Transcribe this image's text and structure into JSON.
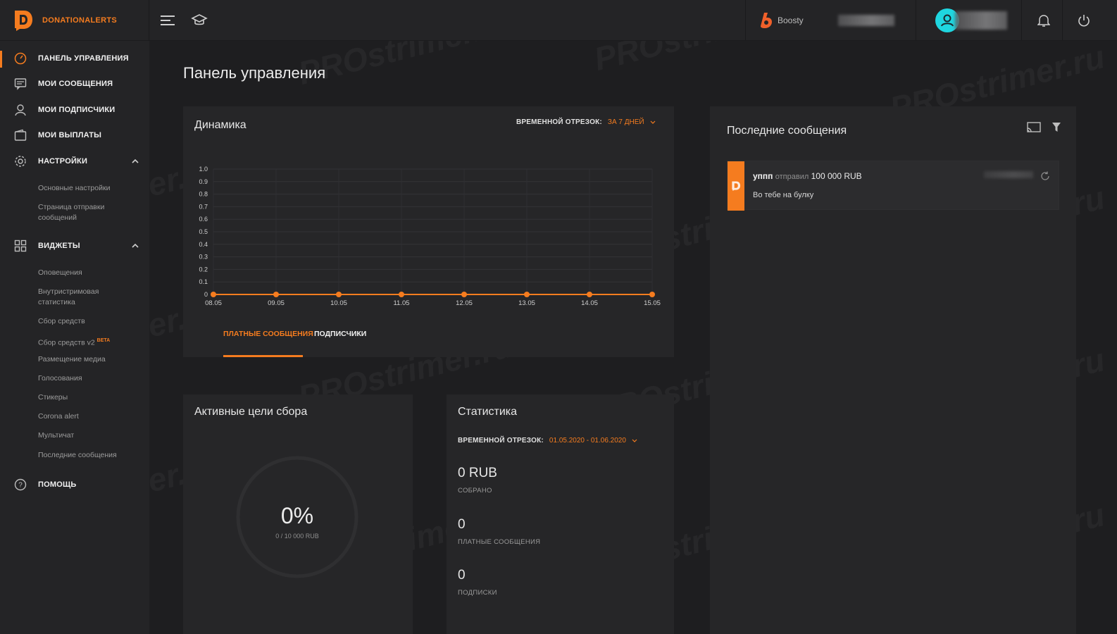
{
  "brand": {
    "name": "DONATIONALERTS",
    "accent": "#f57c1f"
  },
  "topbar": {
    "boosty_label": "Boosty",
    "icons": [
      "menu-icon",
      "graduation-cap-icon",
      "bell-icon",
      "power-icon"
    ]
  },
  "sidebar": {
    "items": [
      {
        "label": "ПАНЕЛЬ УПРАВЛЕНИЯ",
        "icon": "dashboard-icon"
      },
      {
        "label": "МОИ СООБЩЕНИЯ",
        "icon": "messages-icon"
      },
      {
        "label": "МОИ ПОДПИСЧИКИ",
        "icon": "user-icon"
      },
      {
        "label": "МОИ ВЫПЛАТЫ",
        "icon": "wallet-icon"
      },
      {
        "label": "НАСТРОЙКИ",
        "icon": "gear-icon"
      },
      {
        "label": "ВИДЖЕТЫ",
        "icon": "widgets-icon"
      },
      {
        "label": "ПОМОЩЬ",
        "icon": "help-icon"
      }
    ],
    "settings_sub": [
      "Основные настройки",
      "Страница отправки сообщений"
    ],
    "widgets_sub": [
      "Оповещения",
      "Внутристримовая статистика",
      "Сбор средств",
      "Сбор средств v2",
      "Размещение медиа",
      "Голосования",
      "Стикеры",
      "Corona alert",
      "Мультичат",
      "Последние сообщения"
    ],
    "beta_label": "BETA"
  },
  "main": {
    "title": "Панель управления",
    "dynamics": {
      "title": "Динамика",
      "period_label": "ВРЕМЕННОЙ ОТРЕЗОК:",
      "period_value": "ЗА 7 ДНЕЙ",
      "tabs": [
        "ПЛАТНЫЕ СООБЩЕНИЯ",
        "ПОДПИСЧИКИ"
      ]
    },
    "goals": {
      "title": "Активные цели сбора",
      "percent": "0%",
      "progress_text": "0 / 10 000 RUB",
      "progress": 0
    },
    "stats": {
      "title": "Статистика",
      "period_label": "ВРЕМЕННОЙ ОТРЕЗОК:",
      "period_value": "01.05.2020 - 01.06.2020",
      "collected_value": "0 RUB",
      "collected_label": "СОБРАНО",
      "paid_value": "0",
      "paid_label": "ПЛАТНЫЕ СООБЩЕНИЯ",
      "subs_value": "0",
      "subs_label": "ПОДПИСКИ"
    },
    "recent": {
      "title": "Последние сообщения",
      "messages": [
        {
          "name": "уппп",
          "verb": "отправил",
          "amount": "100 000 RUB",
          "text": "Во тебе на булку"
        }
      ]
    }
  },
  "watermark": "PROstrimer.ru",
  "chart_data": {
    "type": "line",
    "categories": [
      "08.05",
      "09.05",
      "10.05",
      "11.05",
      "12.05",
      "13.05",
      "14.05",
      "15.05"
    ],
    "values": [
      0,
      0,
      0,
      0,
      0,
      0,
      0,
      0
    ],
    "yticks": [
      "1.0",
      "0.9",
      "0.8",
      "0.7",
      "0.6",
      "0.5",
      "0.4",
      "0.3",
      "0.2",
      "0.1",
      "0"
    ],
    "ylim": [
      0,
      1
    ],
    "grid": true,
    "color": "#f57c1f"
  }
}
